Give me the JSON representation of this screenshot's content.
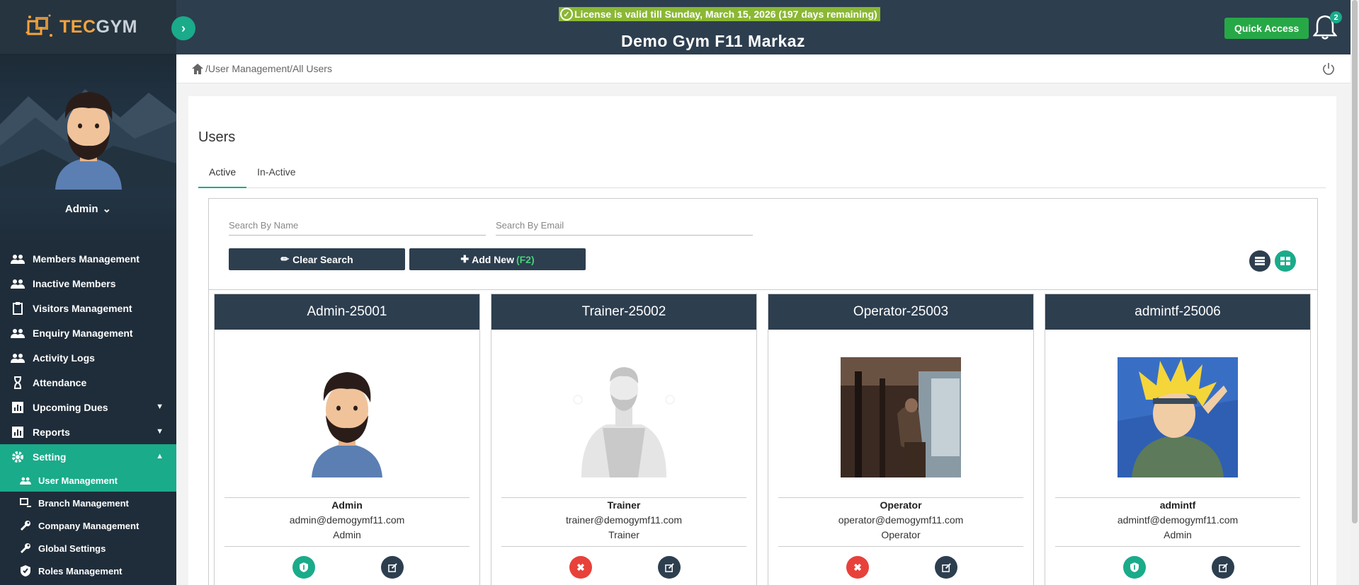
{
  "brand": {
    "tec": "TEC",
    "gym": "GYM"
  },
  "license_text": "License is valid till Sunday, March 15, 2026 (197 days remaining)",
  "gym_title": "Demo Gym F11 Markaz",
  "quick_access": "Quick Access",
  "notification_count": "2",
  "profile": {
    "name": "Admin"
  },
  "menu": [
    {
      "label": "Members Management",
      "icon": "people-icon"
    },
    {
      "label": "Inactive Members",
      "icon": "people-icon"
    },
    {
      "label": "Visitors Management",
      "icon": "clipboard-icon"
    },
    {
      "label": "Enquiry Management",
      "icon": "people-icon"
    },
    {
      "label": "Activity Logs",
      "icon": "people-icon"
    },
    {
      "label": "Attendance",
      "icon": "hourglass-icon"
    },
    {
      "label": "Upcoming Dues",
      "icon": "bar-chart-icon"
    },
    {
      "label": "Reports",
      "icon": "bar-chart-icon"
    },
    {
      "label": "Setting",
      "icon": "gear-icon"
    }
  ],
  "submenu": [
    {
      "label": "User Management",
      "icon": "people-icon"
    },
    {
      "label": "Branch Management",
      "icon": "branch-icon"
    },
    {
      "label": "Company Management",
      "icon": "wrench-icon"
    },
    {
      "label": "Global Settings",
      "icon": "wrench-icon"
    },
    {
      "label": "Roles Management",
      "icon": "shield-icon"
    }
  ],
  "breadcrumb": [
    "User Management",
    "All Users"
  ],
  "page": {
    "title": "Users",
    "tabs": [
      "Active",
      "In-Active"
    ],
    "search_name_placeholder": "Search By Name",
    "search_email_placeholder": "Search By Email",
    "clear_search": "Clear Search",
    "add_new": "Add New",
    "add_new_shortcut": "(F2)"
  },
  "users": [
    {
      "title": "Admin-25001",
      "name": "Admin",
      "email": "admin@demogymf11.com",
      "role": "Admin",
      "status": "active"
    },
    {
      "title": "Trainer-25002",
      "name": "Trainer",
      "email": "trainer@demogymf11.com",
      "role": "Trainer",
      "status": "inactive"
    },
    {
      "title": "Operator-25003",
      "name": "Operator",
      "email": "operator@demogymf11.com",
      "role": "Operator",
      "status": "inactive"
    },
    {
      "title": "admintf-25006",
      "name": "admintf",
      "email": "admintf@demogymf11.com",
      "role": "Admin",
      "status": "active"
    }
  ],
  "colors": {
    "accent": "#1aab8a",
    "dark": "#2d3e4f",
    "license_bg": "#8ab834",
    "danger": "#e8413a",
    "quick": "#27a847"
  }
}
